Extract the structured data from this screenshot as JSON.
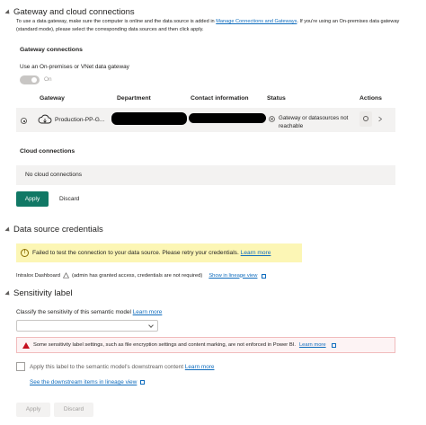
{
  "gateway_section": {
    "title": "Gateway and cloud connections",
    "description_before": "To use a data gateway, make sure the computer is online and the data source is added in ",
    "description_link": "Manage Connections and Gateways",
    "description_after": ". If you're using an On-premises data gateway (standard mode), please select the corresponding data sources and then click apply.",
    "gateway_connections_heading": "Gateway connections",
    "use_gateway_label": "Use an On-premises or VNet data gateway",
    "toggle_state": "On",
    "columns": [
      "Gateway",
      "Department",
      "Contact information",
      "Status",
      "Actions"
    ],
    "gateway_row": {
      "name": "Production-PP-G...",
      "status": "Gateway or datasources not reachable"
    },
    "cloud_connections_heading": "Cloud connections",
    "no_cloud_text": "No cloud connections",
    "apply_label": "Apply",
    "discard_label": "Discard"
  },
  "credentials_section": {
    "title": "Data source credentials",
    "warning_text": "Failed to test the connection to your data source. Please retry your credentials.",
    "warning_link": "Learn more",
    "dataset_name": "Intralox Dashboard",
    "dataset_note": "(admin has granted access, credentials are not required)",
    "lineage_link": "Show in lineage view"
  },
  "sensitivity_section": {
    "title": "Sensitivity label",
    "classify_text": "Classify the sensitivity of this semantic model",
    "classify_link": "Learn more",
    "error_text": "Some sensitivity label settings, such as file encryption settings and content marking, are not enforced in Power BI.",
    "error_link": "Learn more",
    "downstream_label": "Apply this label to the semantic model's downstream content",
    "downstream_link": "Learn more",
    "downstream_items_link": "See the downstream items in lineage view",
    "apply_label": "Apply",
    "discard_label": "Discard"
  }
}
